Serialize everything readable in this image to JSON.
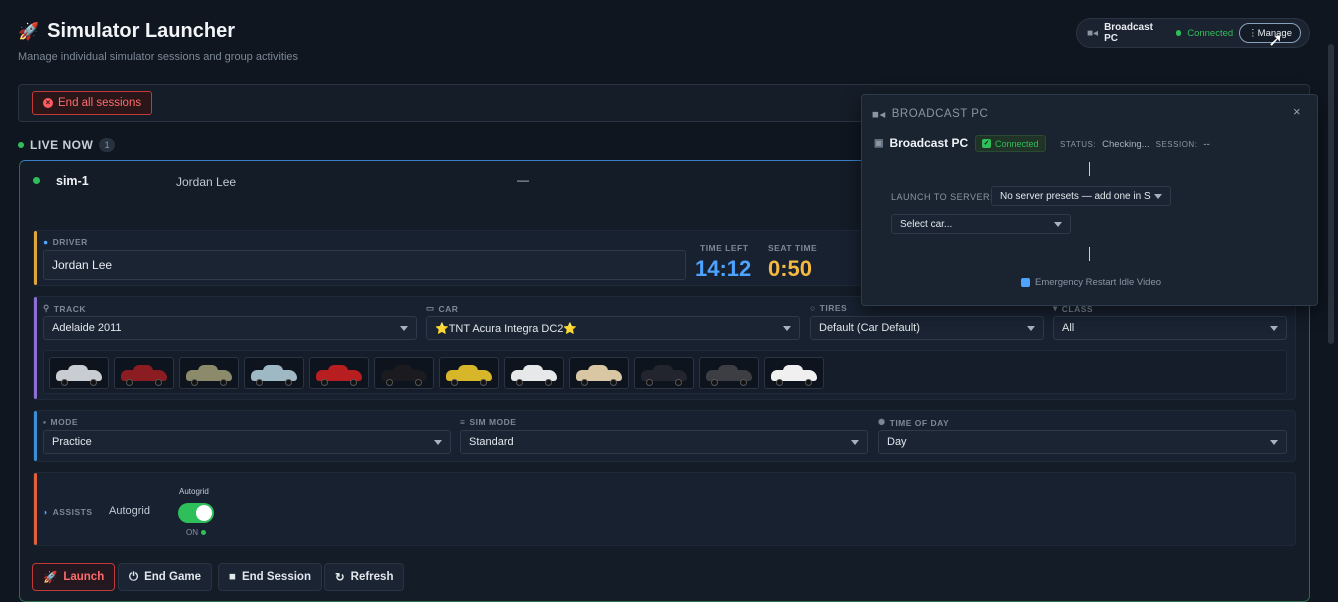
{
  "header": {
    "title": "Simulator Launcher",
    "subtitle": "Manage individual simulator sessions and group activities",
    "broadcast": {
      "name": "Broadcast PC",
      "status": "Connected",
      "manage_label": "Manage"
    }
  },
  "toolbar": {
    "end_all_label": "End all sessions"
  },
  "live": {
    "label": "LIVE NOW",
    "count": "1"
  },
  "sim": {
    "id": "sim-1",
    "driver_name": "Jordan Lee",
    "dash": "—",
    "driver": {
      "label": "DRIVER",
      "value": "Jordan Lee"
    },
    "time_left": {
      "label": "TIME LEFT",
      "value": "14:12"
    },
    "seat_time": {
      "label": "SEAT TIME",
      "value": "0:50"
    },
    "track": {
      "label": "TRACK",
      "value": "Adelaide 2011"
    },
    "car": {
      "label": "CAR",
      "value": "⭐TNT Acura Integra DC2⭐"
    },
    "tires": {
      "label": "TIRES",
      "value": "Default (Car Default)"
    },
    "class": {
      "label": "CLASS",
      "value": "All"
    },
    "car_colors": [
      "#c9cdd2",
      "#8a1c22",
      "#8b8a6a",
      "#9fb9c4",
      "#b81d1f",
      "#1a1a1f",
      "#d8b62a",
      "#e6e8ea",
      "#d9c7a4",
      "#23252e",
      "#3c3e44",
      "#f0f0f0"
    ],
    "mode": {
      "label": "MODE",
      "value": "Practice"
    },
    "sim_mode": {
      "label": "SIM MODE",
      "value": "Standard"
    },
    "time_of_day": {
      "label": "TIME OF DAY",
      "value": "Day"
    },
    "assists": {
      "label": "ASSISTS",
      "value": "Autogrid",
      "toggle_label": "Autogrid",
      "toggle_state": "ON"
    },
    "actions": {
      "launch": "Launch",
      "end_game": "End Game",
      "end_session": "End Session",
      "refresh": "Refresh"
    }
  },
  "popup": {
    "title": "BROADCAST PC",
    "name": "Broadcast PC",
    "badge": "Connected",
    "status_label": "STATUS:",
    "status_value": "Checking...",
    "session_label": "SESSION:",
    "session_value": "--",
    "launch_label": "LAUNCH TO SERVER:",
    "server_select": "No server presets — add one in S",
    "car_select": "Select car...",
    "emergency": "Emergency Restart Idle Video"
  },
  "colors": {
    "accent": "#4da3ff",
    "success": "#2fbf5a",
    "danger": "#ff6b6b",
    "warning": "#f5b942"
  }
}
